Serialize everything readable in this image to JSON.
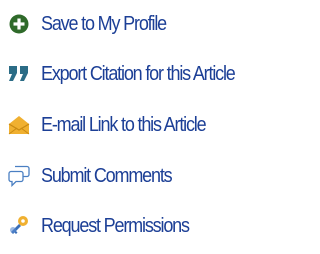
{
  "article_tools": {
    "items": [
      {
        "label": "Save to My Profile",
        "icon": "add-circle-icon"
      },
      {
        "label": "Export Citation for this Article",
        "icon": "quote-icon"
      },
      {
        "label": "E-mail Link to this Article",
        "icon": "envelope-icon"
      },
      {
        "label": "Submit Comments",
        "icon": "speech-bubbles-icon"
      },
      {
        "label": "Request Permissions",
        "icon": "key-icon"
      }
    ]
  },
  "colors": {
    "link_text": "#1c3f96",
    "save_icon": "#2f6a2a",
    "quote_icon": "#2b6c86",
    "envelope_icon": "#f0b030",
    "comments_icon": "#4a7fc2",
    "key_icon": "#3b6fb8"
  }
}
